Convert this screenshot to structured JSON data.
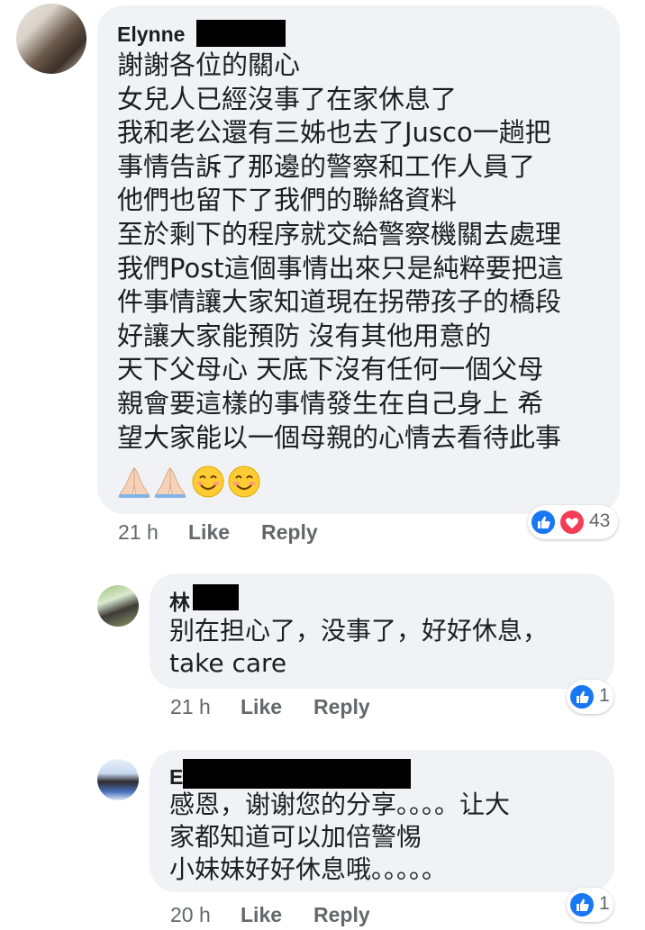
{
  "comments": [
    {
      "author": "Elynne",
      "lines": [
        "謝謝各位的關心",
        "女兒人已經沒事了在家休息了",
        "我和老公還有三姊也去了Jusco一趟把",
        "事情告訴了那邊的警察和工作人員了",
        "他們也留下了我們的聯絡資料",
        "至於剩下的程序就交給警察機關去處理",
        "我們Post這個事情出來只是純粹要把這",
        "件事情讓大家知道現在拐帶孩子的橋段",
        "好讓大家能預防 沒有其他用意的",
        "天下父母心 天底下沒有任何一個父母",
        "親會要這樣的事情發生在自己身上 希",
        "望大家能以一個母親的心情去看待此事"
      ],
      "emojis": [
        "🙏🏻",
        "🙏🏻",
        "😊",
        "😊"
      ],
      "time": "21 h",
      "like_label": "Like",
      "reply_label": "Reply",
      "reaction_count": "43"
    },
    {
      "author": "林",
      "lines": [
        "别在担心了，没事了，好好休息，",
        "take care"
      ],
      "time": "21 h",
      "like_label": "Like",
      "reply_label": "Reply",
      "reaction_count": "1"
    },
    {
      "author": "E",
      "lines": [
        "感恩，谢谢您的分享。。。。让大",
        "家都知道可以加倍警惕",
        "小妹妹好好休息哦。。。。。"
      ],
      "time": "20 h",
      "like_label": "Like",
      "reply_label": "Reply",
      "reaction_count": "1"
    }
  ],
  "colors": {
    "bubble": "#f0f2f5",
    "like_blue": "#1877f2",
    "love_red": "#f33e58",
    "meta_gray": "#65676b"
  },
  "icons": [
    "like-reaction-icon",
    "love-reaction-icon"
  ]
}
